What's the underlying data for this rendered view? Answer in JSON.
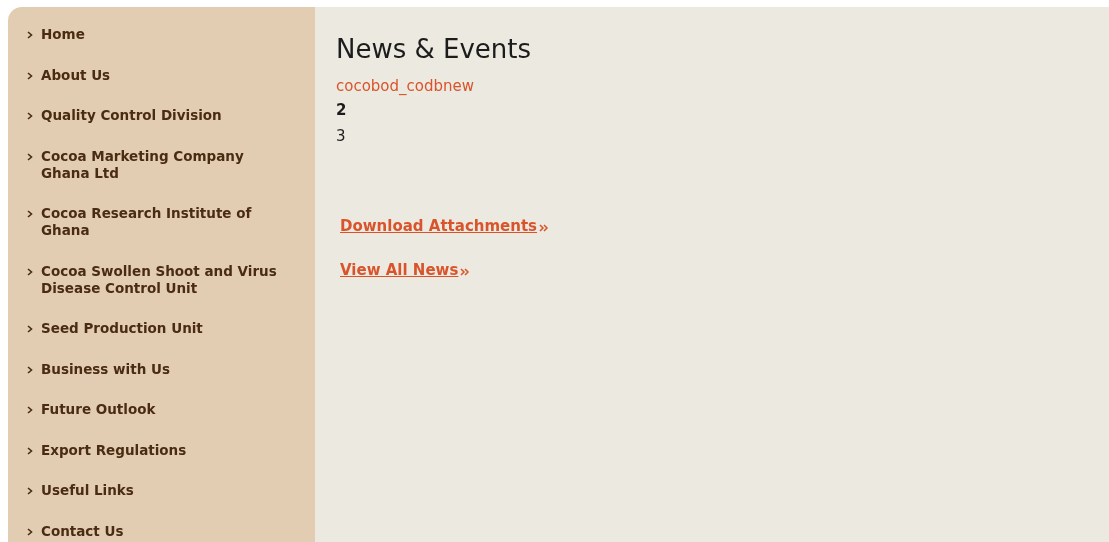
{
  "sidebar": {
    "items": [
      {
        "label": "Home"
      },
      {
        "label": "About Us"
      },
      {
        "label": "Quality Control Division"
      },
      {
        "label": "Cocoa Marketing Company Ghana Ltd"
      },
      {
        "label": "Cocoa Research Institute of Ghana"
      },
      {
        "label": "Cocoa Swollen Shoot and Virus Disease Control Unit"
      },
      {
        "label": "Seed Production Unit"
      },
      {
        "label": "Business with Us"
      },
      {
        "label": "Future Outlook"
      },
      {
        "label": "Export Regulations"
      },
      {
        "label": "Useful Links"
      },
      {
        "label": "Contact Us"
      }
    ]
  },
  "main": {
    "title": "News & Events",
    "subtitle_link": "cocobod_codbnew",
    "lines": [
      {
        "text": "2",
        "bold": true
      },
      {
        "text": "3",
        "bold": false
      }
    ],
    "links": [
      "Download Attachments",
      "View All News"
    ]
  }
}
